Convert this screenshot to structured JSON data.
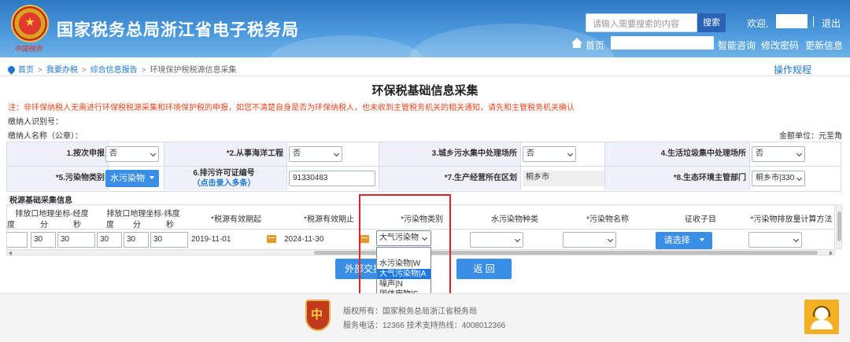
{
  "header": {
    "site_title": "国家税务总局浙江省电子税务局",
    "signature": "中国税务",
    "search_placeholder": "请输入需要搜索的内容",
    "search_button": "搜索",
    "welcome": "欢迎,",
    "logout": "退出",
    "home": "首页",
    "links": [
      "智能咨询",
      "修改密码",
      "更新信息"
    ]
  },
  "breadcrumb": {
    "items": [
      "首页",
      "我要办税",
      "综合信息报告",
      "环境保护税税源信息采集"
    ],
    "separator": ">"
  },
  "rules_link": "操作规程",
  "page_title": "环保税基础信息采集",
  "notice": "注：非环保纳税人无需进行环保税税源采集和环境保护税的申报，如您不清楚自身是否为环保纳税人，也未收到主管税务机关的相关通知，请先和主管税务机关确认",
  "taxpayer": {
    "id_label": "缴纳人识别号：",
    "name_label": "缴纳人名称（公章）：",
    "unit": "金额单位：元至角"
  },
  "info": {
    "row1": [
      {
        "label": "1.按次申报",
        "value": "否"
      },
      {
        "label": "*2.从事海洋工程",
        "value": "否"
      },
      {
        "label": "3.城乡污水集中处理场所",
        "value": "否"
      },
      {
        "label": "4.生活垃圾集中处理场所",
        "value": "否"
      }
    ],
    "row2": {
      "pollutant_label": "*5.污染物类别",
      "pollutant_button": "水污染物",
      "permit_label": "6.排污许可证编号",
      "permit_sub": "（点击录入多条）",
      "permit_value": "91330483",
      "area_label": "*7.生产经营所在区划",
      "area_value": "桐乡市",
      "bureau_label": "*8.生态环境主管部门",
      "bureau_value": "桐乡市|330"
    }
  },
  "section_title": "税源基础采集信息",
  "grid": {
    "group_headers": [
      "排放口地理坐标-经度",
      "排放口地理坐标-纬度"
    ],
    "sub_headers": [
      "度",
      "分",
      "秒",
      "度",
      "分",
      "秒"
    ],
    "headers": [
      "*税源有效期起",
      "*税源有效期止",
      "*污染物类别",
      "水污染物种类",
      "*污染物名称",
      "征收子目",
      "*污染物排放量计算方法"
    ],
    "row": {
      "lon": [
        "",
        "30",
        "30"
      ],
      "lat": [
        "30",
        "30",
        "30"
      ],
      "start": "2019-11-01",
      "end": "2024-11-30",
      "pollutant_type": "大气污染物",
      "tax_item_button": "请选择"
    }
  },
  "dropdown": {
    "options": [
      "水污染物|W",
      "大气污染物|A",
      "噪声|N",
      "固体废物|S"
    ],
    "selected_index": 1
  },
  "buttons": {
    "external": "外部交换",
    "back": "返 回"
  },
  "footer": {
    "copyright": "版权所有：国家税务总局浙江省税务局",
    "phone": "服务电话：12366 技术支持热线：4008012366",
    "logo_text": "中"
  },
  "colors": {
    "header_blue": "#3a86d0",
    "accent": "#3a8ee6",
    "notice": "#e6461e",
    "highlight": "#e5202a"
  }
}
